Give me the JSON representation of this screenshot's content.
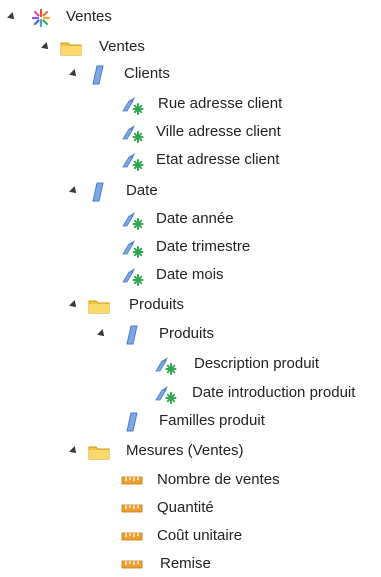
{
  "tree": {
    "root": {
      "label": "Ventes"
    },
    "ventes_folder": {
      "label": "Ventes"
    },
    "clients": {
      "label": "Clients",
      "items": [
        "Rue adresse client",
        "Ville adresse client",
        "Etat adresse client"
      ]
    },
    "date": {
      "label": "Date",
      "items": [
        "Date année",
        "Date trimestre",
        "Date mois"
      ]
    },
    "produits_folder": {
      "label": "Produits"
    },
    "produits_dim": {
      "label": "Produits",
      "items": [
        "Description produit",
        "Date introduction produit"
      ]
    },
    "familles": {
      "label": "Familles produit"
    },
    "mesures_folder": {
      "label": "Mesures (Ventes)",
      "items": [
        "Nombre de ventes",
        "Quantité",
        "Coût unitaire",
        "Remise"
      ]
    }
  },
  "colors": {
    "folder": "#f5c542",
    "dimension": "#5b8ed6",
    "attribute_star": "#2fa84f",
    "measure": "#f0a030"
  }
}
